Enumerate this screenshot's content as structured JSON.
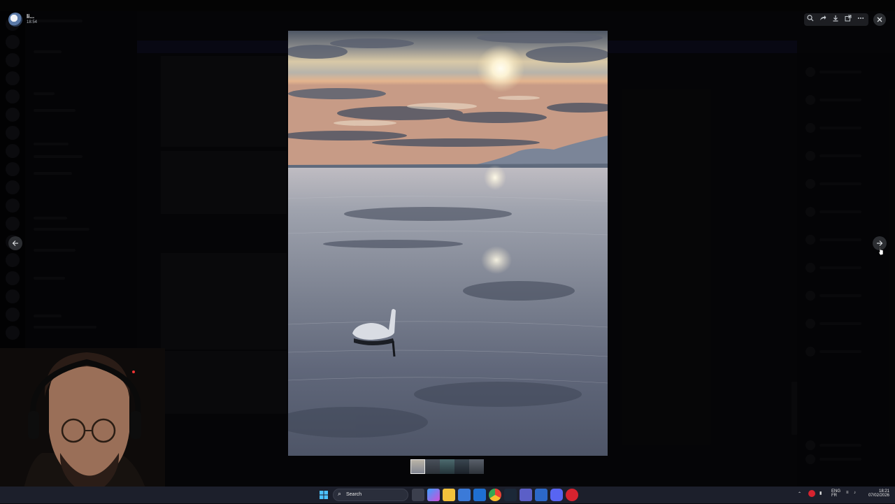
{
  "viewer": {
    "user_name": "li...",
    "timestamp": "18:54",
    "toolbar_icons": [
      "zoom-icon",
      "forward-icon",
      "download-icon",
      "open-external-icon",
      "more-icon"
    ],
    "close_icon": "close-icon",
    "prev_icon": "arrow-left-icon",
    "next_icon": "arrow-right-icon",
    "image_subject": "swan on a lake at sunset",
    "thumbnail_count": 5,
    "selected_thumbnail": 1
  },
  "taskbar": {
    "search_placeholder": "Search",
    "apps": [
      "task-view-icon",
      "copilot-icon",
      "file-explorer-icon",
      "microsoft-store-icon",
      "mail-icon",
      "chrome-icon",
      "steam-icon",
      "teams-icon",
      "phone-link-icon",
      "discord-icon",
      "opera-icon"
    ],
    "lang_top": "ENG",
    "lang_bottom": "FR",
    "time": "18:21",
    "date": "07/02/2026"
  },
  "colors": {
    "viewer_button_bg": "#2b2d31",
    "taskbar_bg": "#1c1f2b",
    "discord_accent": "#5865f2"
  }
}
